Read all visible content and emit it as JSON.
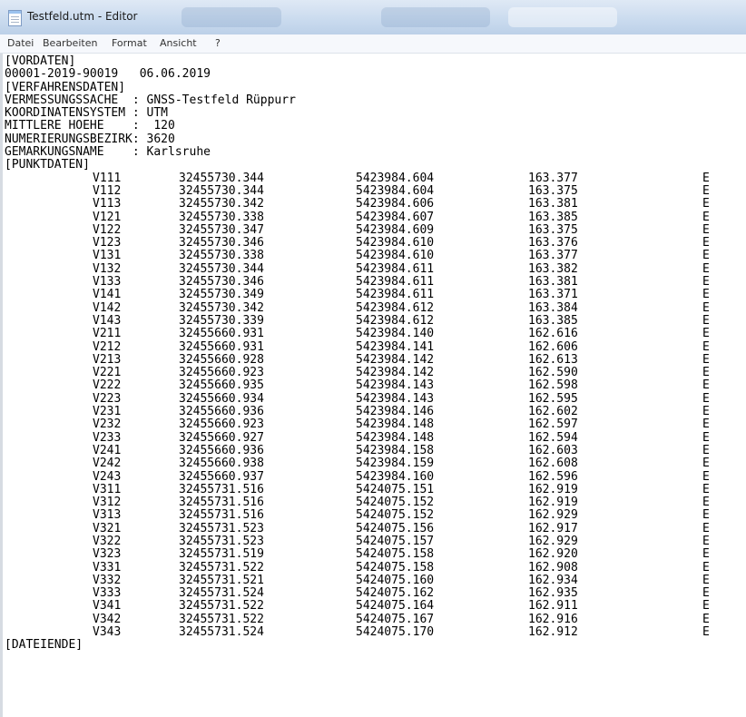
{
  "window": {
    "title": "Testfeld.utm - Editor"
  },
  "menu": [
    {
      "id": "datei",
      "label": "Datei"
    },
    {
      "id": "bearbeiten",
      "label": "Bearbeiten"
    },
    {
      "id": "format",
      "label": "Format"
    },
    {
      "id": "ansicht",
      "label": "Ansicht"
    },
    {
      "id": "hilfe",
      "label": "?"
    }
  ],
  "header": {
    "vordaten": "[VORDATEN]",
    "vordaten_line": "00001-2019-90019   06.06.2019",
    "verfahrensdaten": "[VERFAHRENSDATEN]",
    "fields": [
      "VERMESSUNGSSACHE  : GNSS-Testfeld Rüppurr",
      "KOORDINATENSYSTEM : UTM",
      "MITTLERE HOEHE    :  120",
      "NUMERIERUNGSBEZIRK: 3620",
      "GEMARKUNGSNAME    : Karlsruhe"
    ],
    "punktdaten": "[PUNKTDATEN]"
  },
  "points": [
    [
      "V111",
      "32455730.344",
      "5423984.604",
      "163.377",
      "E"
    ],
    [
      "V112",
      "32455730.344",
      "5423984.604",
      "163.375",
      "E"
    ],
    [
      "V113",
      "32455730.342",
      "5423984.606",
      "163.381",
      "E"
    ],
    [
      "V121",
      "32455730.338",
      "5423984.607",
      "163.385",
      "E"
    ],
    [
      "V122",
      "32455730.347",
      "5423984.609",
      "163.375",
      "E"
    ],
    [
      "V123",
      "32455730.346",
      "5423984.610",
      "163.376",
      "E"
    ],
    [
      "V131",
      "32455730.338",
      "5423984.610",
      "163.377",
      "E"
    ],
    [
      "V132",
      "32455730.344",
      "5423984.611",
      "163.382",
      "E"
    ],
    [
      "V133",
      "32455730.346",
      "5423984.611",
      "163.381",
      "E"
    ],
    [
      "V141",
      "32455730.349",
      "5423984.611",
      "163.371",
      "E"
    ],
    [
      "V142",
      "32455730.342",
      "5423984.612",
      "163.384",
      "E"
    ],
    [
      "V143",
      "32455730.339",
      "5423984.612",
      "163.385",
      "E"
    ],
    [
      "V211",
      "32455660.931",
      "5423984.140",
      "162.616",
      "E"
    ],
    [
      "V212",
      "32455660.931",
      "5423984.141",
      "162.606",
      "E"
    ],
    [
      "V213",
      "32455660.928",
      "5423984.142",
      "162.613",
      "E"
    ],
    [
      "V221",
      "32455660.923",
      "5423984.142",
      "162.590",
      "E"
    ],
    [
      "V222",
      "32455660.935",
      "5423984.143",
      "162.598",
      "E"
    ],
    [
      "V223",
      "32455660.934",
      "5423984.143",
      "162.595",
      "E"
    ],
    [
      "V231",
      "32455660.936",
      "5423984.146",
      "162.602",
      "E"
    ],
    [
      "V232",
      "32455660.923",
      "5423984.148",
      "162.597",
      "E"
    ],
    [
      "V233",
      "32455660.927",
      "5423984.148",
      "162.594",
      "E"
    ],
    [
      "V241",
      "32455660.936",
      "5423984.158",
      "162.603",
      "E"
    ],
    [
      "V242",
      "32455660.938",
      "5423984.159",
      "162.608",
      "E"
    ],
    [
      "V243",
      "32455660.937",
      "5423984.160",
      "162.596",
      "E"
    ],
    [
      "V311",
      "32455731.516",
      "5424075.151",
      "162.919",
      "E"
    ],
    [
      "V312",
      "32455731.516",
      "5424075.152",
      "162.919",
      "E"
    ],
    [
      "V313",
      "32455731.516",
      "5424075.152",
      "162.929",
      "E"
    ],
    [
      "V321",
      "32455731.523",
      "5424075.156",
      "162.917",
      "E"
    ],
    [
      "V322",
      "32455731.523",
      "5424075.157",
      "162.929",
      "E"
    ],
    [
      "V323",
      "32455731.519",
      "5424075.158",
      "162.920",
      "E"
    ],
    [
      "V331",
      "32455731.522",
      "5424075.158",
      "162.908",
      "E"
    ],
    [
      "V332",
      "32455731.521",
      "5424075.160",
      "162.934",
      "E"
    ],
    [
      "V333",
      "32455731.524",
      "5424075.162",
      "162.935",
      "E"
    ],
    [
      "V341",
      "32455731.522",
      "5424075.164",
      "162.911",
      "E"
    ],
    [
      "V342",
      "32455731.522",
      "5424075.167",
      "162.916",
      "E"
    ],
    [
      "V343",
      "32455731.524",
      "5424075.170",
      "162.912",
      "E"
    ]
  ],
  "footer": "[DATEIENDE]"
}
